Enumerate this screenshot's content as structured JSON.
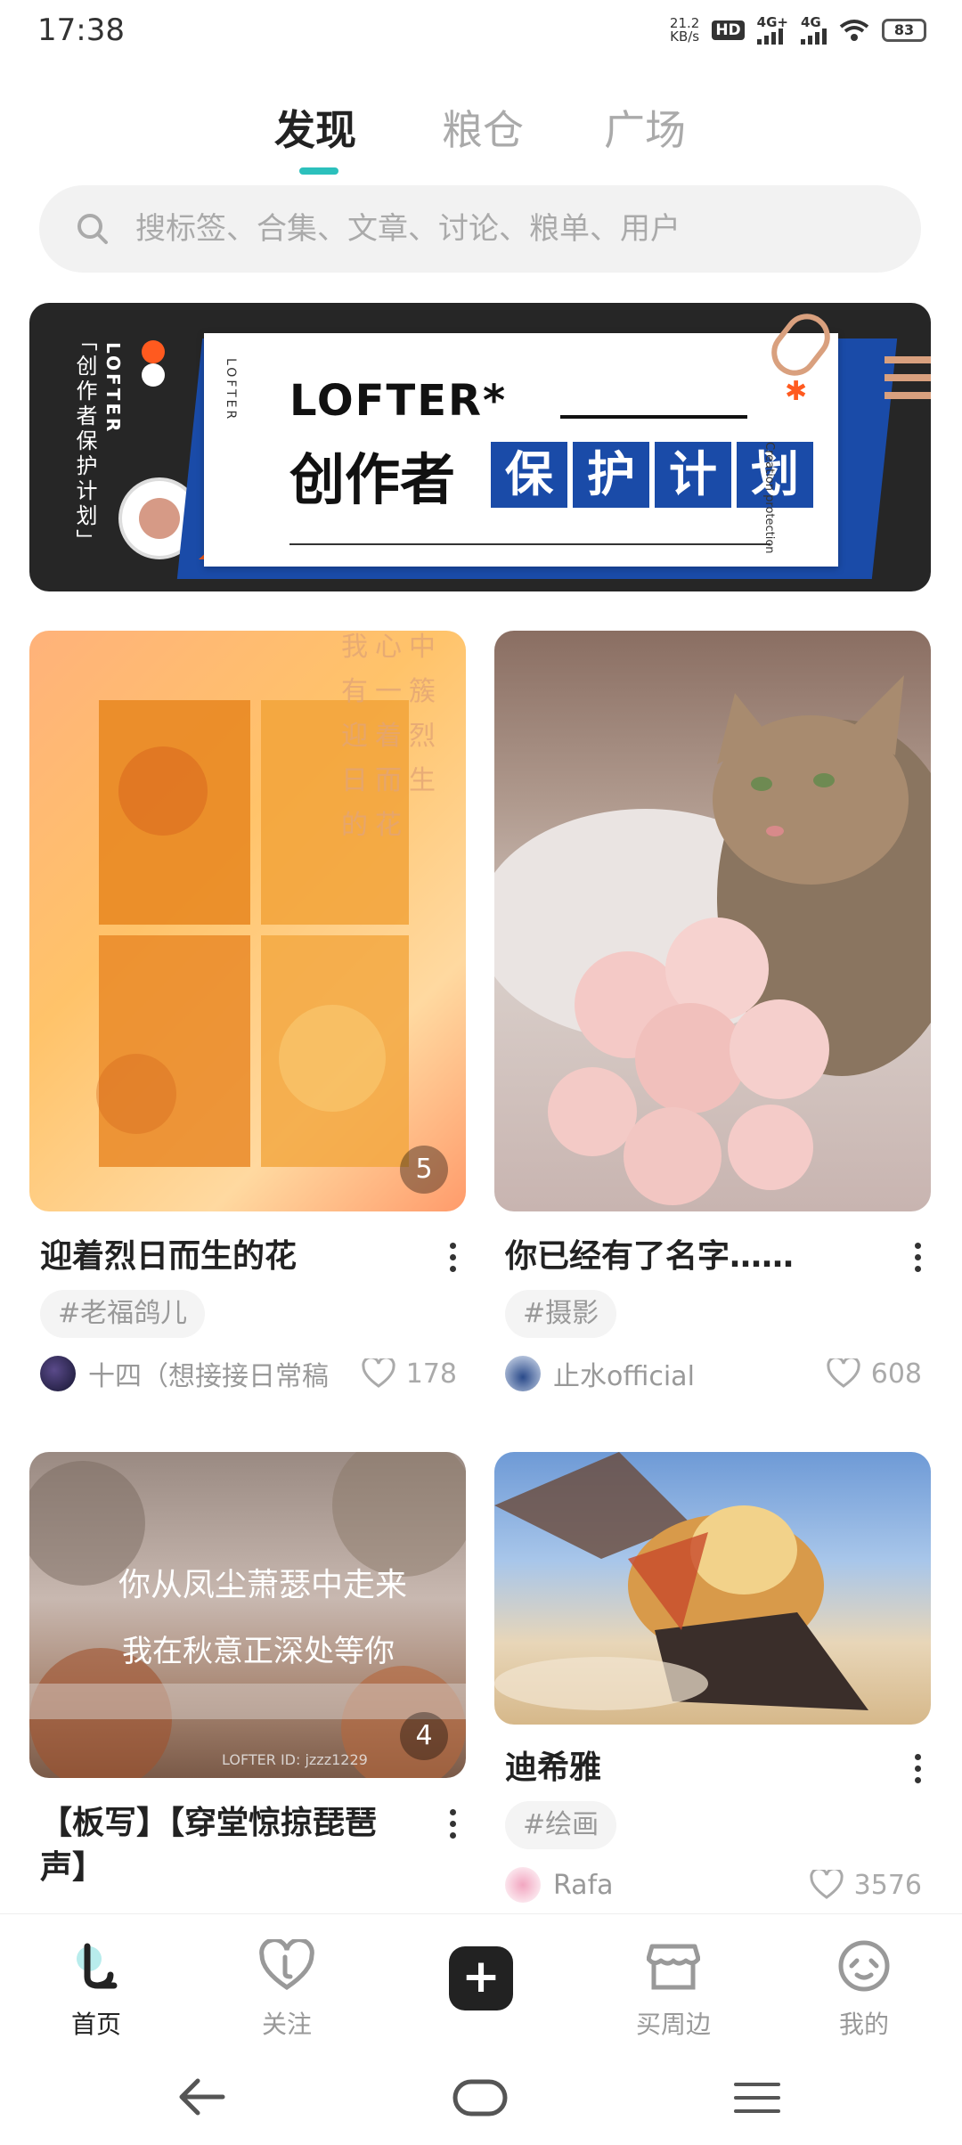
{
  "status": {
    "time": "17:38",
    "net_speed": "21.2",
    "net_unit": "KB/s",
    "hd": "HD",
    "sim1": "4G+",
    "sim2": "4G",
    "battery": "83"
  },
  "tabs": [
    {
      "label": "发现"
    },
    {
      "label": "粮仓"
    },
    {
      "label": "广场"
    }
  ],
  "search": {
    "placeholder": "搜标签、合集、文章、讨论、粮单、用户"
  },
  "banner": {
    "vertical_cn": "「创作者保护计划」",
    "vertical_en": "LOFTER",
    "brand": "LOFTER*",
    "headline": "创作者",
    "highlight": [
      "保",
      "护",
      "计",
      "划"
    ],
    "side_text": "Creation protection",
    "badge_text": "创作者"
  },
  "cards": [
    {
      "title": "迎着烈日而生的花",
      "tag": "#老福鸽儿",
      "author": "十四（想接接日常稿版）",
      "likes": "178",
      "count": "5",
      "overlay_text": "我心中有一簇迎着烈日而生的花"
    },
    {
      "title": "你已经有了名字……",
      "tag": "#摄影",
      "author": "止水official",
      "likes": "608"
    },
    {
      "title": "【板写】【穿堂惊掠琵琶声】",
      "count": "4",
      "overlay_line1": "你从凤尘萧瑟中走来",
      "overlay_line2": "我在秋意正深处等你",
      "watermark": "LOFTER ID: jzzz1229"
    },
    {
      "title": "迪希雅",
      "tag": "#绘画",
      "author": "Rafa",
      "likes": "3576"
    }
  ],
  "nav": [
    {
      "label": "首页"
    },
    {
      "label": "关注"
    },
    {
      "label": "+"
    },
    {
      "label": "买周边"
    },
    {
      "label": "我的"
    }
  ]
}
